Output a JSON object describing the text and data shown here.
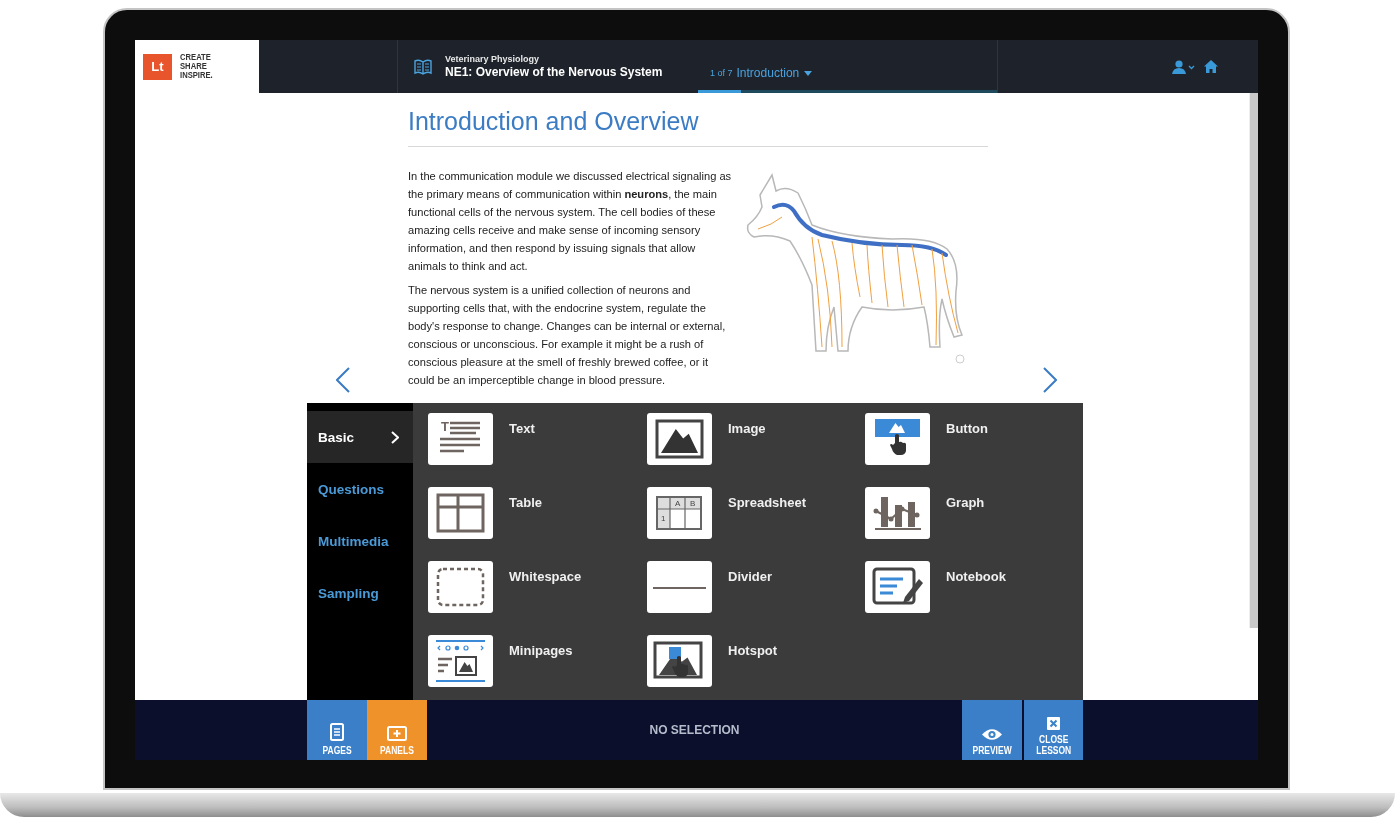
{
  "header": {
    "logo": {
      "mark": "Lt",
      "tagline": [
        "CREATE",
        "SHARE",
        "INSPIRE."
      ]
    },
    "course": "Veterinary Physiology",
    "lesson": "NE1: Overview of the Nervous System",
    "page_counter": "1 of 7",
    "page_menu": "Introduction",
    "progress": {
      "level": 0.143
    }
  },
  "page": {
    "title": "Introduction and Overview",
    "paragraphs": [
      "In the communication module we discussed electrical signaling as the primary means of communication within **neurons**, the main functional cells of the nervous system. The cell bodies of these amazing cells receive and make sense of incoming sensory information, and then respond by issuing signals that allow animals to think and act.",
      "The nervous system is a unified collection of neurons and supporting cells that, with the endocrine system, regulate the body's response to change. Changes can be internal or external, conscious or unconscious. For example it might be a rush of conscious pleasure at the smell of freshly brewed coffee, or it could be an imperceptible change in blood pressure."
    ]
  },
  "panels": {
    "categories": [
      {
        "label": "Basic",
        "selected": true
      },
      {
        "label": "Questions",
        "selected": false
      },
      {
        "label": "Multimedia",
        "selected": false
      },
      {
        "label": "Sampling",
        "selected": false
      }
    ],
    "items": [
      {
        "label": "Text",
        "kind": "text",
        "icon_labels": [
          "T"
        ]
      },
      {
        "label": "Image",
        "kind": "image"
      },
      {
        "label": "Button",
        "kind": "button"
      },
      {
        "label": "Table",
        "kind": "table"
      },
      {
        "label": "Spreadsheet",
        "kind": "spreadsheet",
        "icon_labels": [
          "A",
          "B",
          "1"
        ]
      },
      {
        "label": "Graph",
        "kind": "graph"
      },
      {
        "label": "Whitespace",
        "kind": "whitespace"
      },
      {
        "label": "Divider",
        "kind": "divider"
      },
      {
        "label": "Notebook",
        "kind": "notebook"
      },
      {
        "label": "Minipages",
        "kind": "minipages"
      },
      {
        "label": "Hotspot",
        "kind": "hotspot"
      }
    ]
  },
  "bottom_bar": {
    "left_buttons": [
      {
        "label": "PAGES",
        "kind": "pages",
        "selected": false
      },
      {
        "label": "PANELS",
        "kind": "panels",
        "selected": true
      }
    ],
    "status": "NO SELECTION",
    "right_buttons": [
      {
        "label": "PREVIEW",
        "kind": "preview"
      },
      {
        "label": "CLOSE LESSON",
        "kind": "close"
      }
    ]
  }
}
